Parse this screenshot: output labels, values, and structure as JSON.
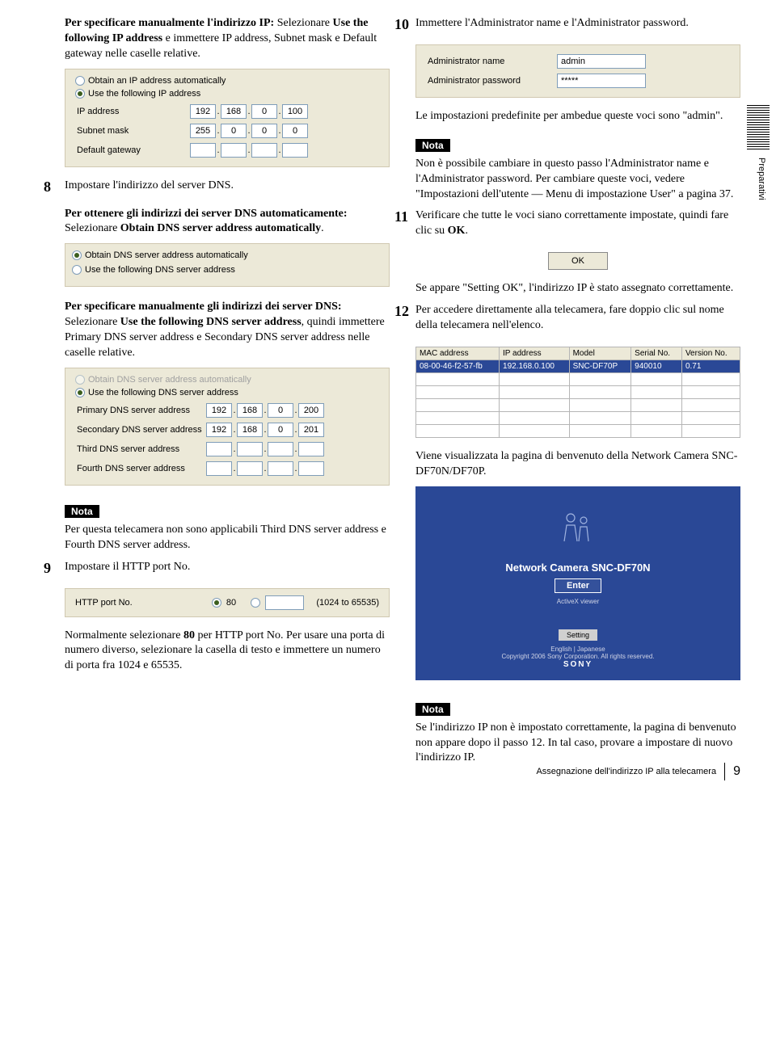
{
  "left": {
    "intro_para": {
      "bold1": "Per specificare manualmente l'indirizzo IP:",
      "rest": " Selezionare ",
      "bold2": "Use the following IP address",
      "rest2": " e immettere IP address, Subnet mask e Default gateway nelle caselle relative."
    },
    "ip_panel": {
      "radio_auto": "Obtain an IP address automatically",
      "radio_static": "Use the following IP address",
      "lbl_ip": "IP address",
      "lbl_subnet": "Subnet mask",
      "lbl_gw": "Default gateway",
      "ip": [
        "192",
        "168",
        "0",
        "100"
      ],
      "subnet": [
        "255",
        "0",
        "0",
        "0"
      ],
      "gw": [
        "",
        "",
        "",
        ""
      ]
    },
    "step8_num": "8",
    "step8_text": "Impostare l'indirizzo del server DNS.",
    "dns_auto": {
      "bold": "Per ottenere gli indirizzi dei server DNS automaticamente:",
      "rest": " Selezionare ",
      "bold2": "Obtain DNS server address automatically",
      "rest2": "."
    },
    "dns_radio": {
      "auto": "Obtain DNS server address automatically",
      "manual": "Use the following DNS server address"
    },
    "dns_manual": {
      "bold": "Per specificare manualmente gli indirizzi dei server DNS:",
      "rest": " Selezionare ",
      "bold2": "Use the following DNS server address",
      "rest2": ", quindi immettere Primary DNS server address e Secondary DNS server address nelle caselle relative."
    },
    "dns_panel": {
      "lbl_primary": "Primary DNS server address",
      "lbl_secondary": "Secondary DNS server address",
      "lbl_third": "Third DNS server address",
      "lbl_fourth": "Fourth DNS server address",
      "primary": [
        "192",
        "168",
        "0",
        "200"
      ],
      "secondary": [
        "192",
        "168",
        "0",
        "201"
      ]
    },
    "nota_label": "Nota",
    "nota_dns": "Per questa telecamera non sono applicabili Third DNS server address e Fourth DNS server address.",
    "step9_num": "9",
    "step9_text": "Impostare il HTTP port No.",
    "http_panel": {
      "label": "HTTP port No.",
      "opt80": "80",
      "range": "(1024 to 65535)"
    },
    "http_text1": "Normalmente selezionare ",
    "http_text1_b": "80",
    "http_text1_end": " per HTTP port No. Per usare una porta di numero diverso, selezionare la casella di testo e immettere un numero di porta fra 1024 e 65535."
  },
  "right": {
    "step10_num": "10",
    "step10_text": "Immettere l'Administrator name e l'Administrator password.",
    "admin_panel": {
      "lbl_name": "Administrator name",
      "lbl_pw": "Administrator password",
      "name": "admin",
      "pw": "*****"
    },
    "admin_note": "Le impostazioni predefinite per ambedue queste voci sono \"admin\".",
    "nota_label": "Nota",
    "nota_admin": "Non è possibile cambiare in questo passo l'Administrator name e l'Administrator password. Per cambiare queste voci, vedere \"Impostazioni dell'utente — Menu di impostazione User\" a pagina 37.",
    "step11_num": "11",
    "step11_text1": "Verificare che tutte le voci siano correttamente impostate, quindi fare clic su ",
    "step11_text1_b": "OK",
    "step11_text1_end": ".",
    "ok_btn": "OK",
    "step11_res": "Se appare \"Setting OK\", l'indirizzo IP è stato assegnato correttamente.",
    "step12_num": "12",
    "step12_text": "Per accedere direttamente alla telecamera, fare doppio clic sul nome della telecamera nell'elenco.",
    "table_headers": [
      "MAC address",
      "IP address",
      "Model",
      "Serial No.",
      "Version No."
    ],
    "table_row": [
      "08-00-46-f2-57-fb",
      "192.168.0.100",
      "SNC-DF70P",
      "940010",
      "0.71"
    ],
    "welcome_caption": "Viene visualizzata la pagina di benvenuto della Network Camera SNC-DF70N/DF70P.",
    "welcome": {
      "title": "Network Camera SNC-DF70N",
      "enter": "Enter",
      "applet": "ActiveX viewer",
      "setting": "Setting",
      "lang": "English | Japanese",
      "copy": "Copyright 2006 Sony Corporation. All rights reserved.",
      "sony": "SONY"
    },
    "nota_welcome": "Se l'indirizzo IP non è impostato correttamente, la pagina di benvenuto non appare dopo il passo 12. In tal caso, provare a impostare di nuovo l'indirizzo IP."
  },
  "sidebar_tab": "Preparativi",
  "footer": {
    "text": "Assegnazione dell'indirizzo IP alla telecamera",
    "page": "9"
  }
}
